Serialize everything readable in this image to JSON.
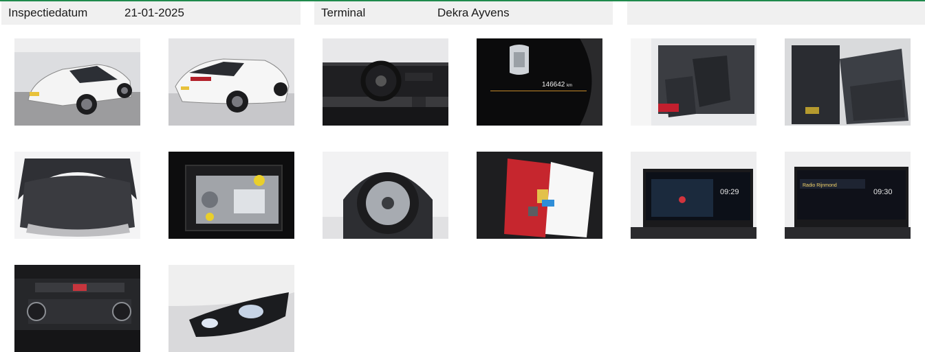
{
  "header": {
    "inspection_label": "Inspectiedatum",
    "inspection_date": "21-01-2025",
    "terminal_label": "Terminal",
    "terminal_value": "Dekra Ayvens",
    "third_panel_text": ""
  },
  "photos": {
    "dashboard_odometer_reading": "146642",
    "dashboard_odometer_unit": "km",
    "radio_clock_1": "09:29",
    "radio_clock_2": "09:30",
    "radio_station_label": "Radio Rijnmond"
  },
  "colors": {
    "accent": "#1f8a4c",
    "header_bg": "#f0f0f0"
  }
}
